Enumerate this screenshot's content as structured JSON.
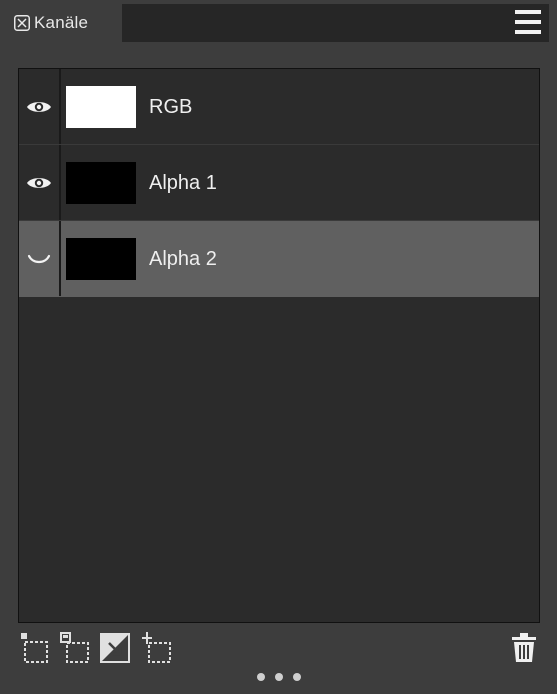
{
  "panel": {
    "tab_title": "Kanäle",
    "close_icon": "close-x-icon",
    "menu_icon": "hamburger-menu-icon"
  },
  "channels": [
    {
      "label": "RGB",
      "visible": true,
      "thumbnail_color": "#ffffff",
      "selected": false
    },
    {
      "label": "Alpha 1",
      "visible": true,
      "thumbnail_color": "#000000",
      "selected": false
    },
    {
      "label": "Alpha 2",
      "visible": false,
      "thumbnail_color": "#000000",
      "selected": true
    }
  ],
  "toolbar": {
    "icons": [
      "load-selection-icon",
      "save-selection-icon",
      "invert-channel-icon",
      "new-channel-icon",
      "trash-icon"
    ]
  },
  "colors": {
    "panel_bg": "#3d3d3d",
    "list_bg": "#2b2b2b",
    "selected_row": "#606060",
    "text": "#efefef"
  }
}
